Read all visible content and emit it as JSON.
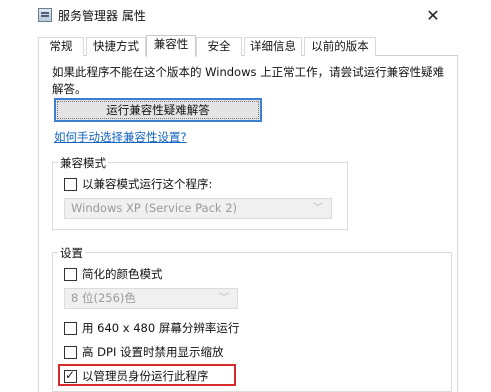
{
  "window": {
    "title": "服务管理器 属性",
    "close_glyph": "✕",
    "icon": "app-window-icon"
  },
  "tabs": [
    {
      "label": "常规",
      "active": false
    },
    {
      "label": "快捷方式",
      "active": false
    },
    {
      "label": "兼容性",
      "active": true
    },
    {
      "label": "安全",
      "active": false
    },
    {
      "label": "详细信息",
      "active": false
    },
    {
      "label": "以前的版本",
      "active": false
    }
  ],
  "compat": {
    "intro": "如果此程序不能在这个版本的 Windows 上正常工作，请尝试运行兼容性疑难解答。",
    "troubleshoot_button": "运行兼容性疑难解答",
    "manual_link": "如何手动选择兼容性设置?",
    "mode_group": {
      "title": "兼容模式",
      "checkbox_label": "以兼容模式运行这个程序:",
      "checked": false,
      "select_value": "Windows XP (Service Pack 2)"
    },
    "settings_group": {
      "title": "设置",
      "reduced_color": {
        "label": "简化的颜色模式",
        "checked": false
      },
      "color_select_value": "8 位(256)色",
      "resolution": {
        "label": "用 640 x 480 屏幕分辨率运行",
        "checked": false
      },
      "dpi": {
        "label": "高 DPI 设置时禁用显示缩放",
        "checked": false
      },
      "run_as_admin": {
        "label": "以管理员身份运行此程序",
        "checked": true
      }
    }
  },
  "colors": {
    "link": "#1565c0",
    "button_focus_border": "#3c7fd1",
    "highlight_box": "#d92b2b"
  }
}
